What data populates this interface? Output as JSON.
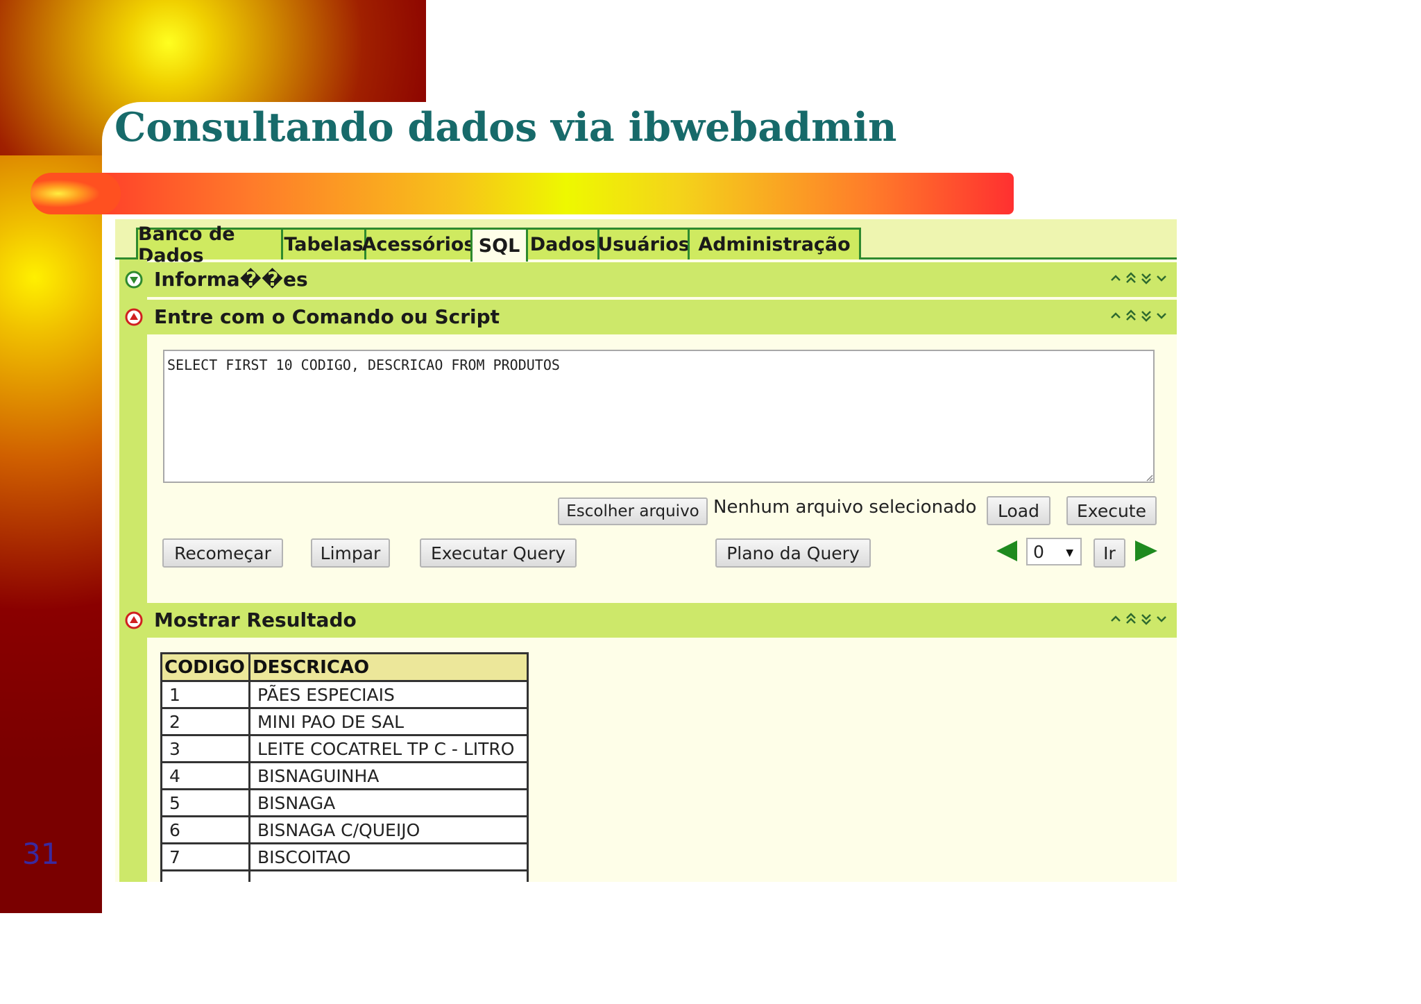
{
  "slide": {
    "title": "Consultando dados via ibwebadmin",
    "page_number": "31"
  },
  "tabs": [
    {
      "label": "Banco de Dados",
      "active": false
    },
    {
      "label": "Tabelas",
      "active": false
    },
    {
      "label": "Acessórios",
      "active": false
    },
    {
      "label": "SQL",
      "active": true
    },
    {
      "label": "Dados",
      "active": false
    },
    {
      "label": "Usuários",
      "active": false
    },
    {
      "label": "Administração",
      "active": false
    }
  ],
  "panels": {
    "info": {
      "title": "Informa��es",
      "icon": "collapse-down-icon",
      "icon_color": "#2e8a2e"
    },
    "command": {
      "title": "Entre com o Comando ou Script",
      "icon": "collapse-up-icon",
      "icon_color": "#d02020"
    },
    "result": {
      "title": "Mostrar Resultado",
      "icon": "collapse-up-icon",
      "icon_color": "#d02020"
    }
  },
  "sql_editor": {
    "value": "SELECT FIRST 10 CODIGO, DESCRICAO FROM PRODUTOS"
  },
  "file_picker": {
    "button_label": "Escolher arquivo",
    "status": "Nenhum arquivo selecionado",
    "load_label": "Load",
    "execute_label": "Execute"
  },
  "actions": {
    "restart_label": "Recomeçar",
    "clear_label": "Limpar",
    "run_query_label": "Executar Query",
    "query_plan_label": "Plano da Query",
    "go_label": "Ir",
    "page_select_value": "0"
  },
  "results": {
    "columns": [
      "CODIGO",
      "DESCRICAO"
    ],
    "rows": [
      {
        "codigo": "1",
        "descricao": "PÃES ESPECIAIS"
      },
      {
        "codigo": "2",
        "descricao": "MINI PAO DE SAL"
      },
      {
        "codigo": "3",
        "descricao": "LEITE COCATREL TP C - LITRO"
      },
      {
        "codigo": "4",
        "descricao": "BISNAGUINHA"
      },
      {
        "codigo": "5",
        "descricao": "BISNAGA"
      },
      {
        "codigo": "6",
        "descricao": "BISNAGA C/QUEIJO"
      },
      {
        "codigo": "7",
        "descricao": "BISCOITAO"
      }
    ]
  },
  "colors": {
    "title": "#176a6a",
    "tab_bg": "#cfea60",
    "tab_border": "#2e8a2e",
    "panel_header": "#cde86a",
    "content_bg": "#fefee8",
    "nav_arrow": "#1e8a1e"
  }
}
